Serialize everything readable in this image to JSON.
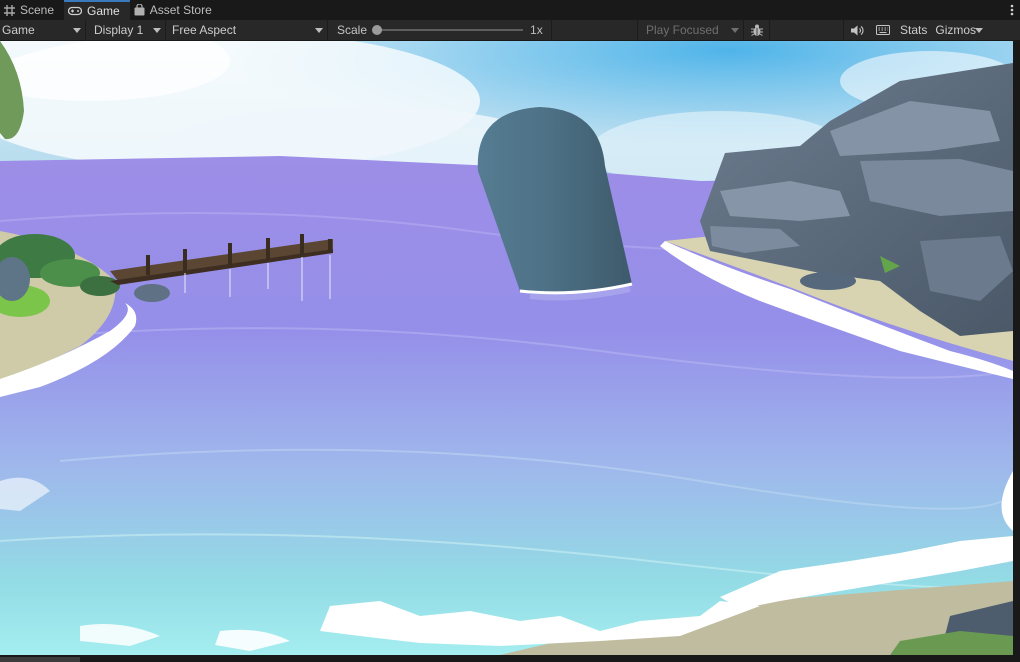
{
  "tabs": [
    {
      "label": "Scene",
      "icon": "scene-grid-icon",
      "active": false
    },
    {
      "label": "Game",
      "icon": "game-controller-icon",
      "active": true
    },
    {
      "label": "Asset Store",
      "icon": "shopping-bag-icon",
      "active": false
    }
  ],
  "tab_menu_icon": "kebab-menu-icon",
  "toolbar": {
    "view_mode": "Game",
    "display": "Display 1",
    "aspect": "Free Aspect",
    "scale_label": "Scale",
    "scale_value": "1x",
    "scale_fraction": 0.0,
    "play_mode": "Play Focused",
    "bug_icon": "bug-icon",
    "audio_icon": "speaker-icon",
    "keyboard_icon": "keyboard-icon",
    "stats": "Stats",
    "gizmos": "Gizmos"
  },
  "colors": {
    "accent": "#3a79bb",
    "panel": "#282828",
    "background": "#191919",
    "water_violet": "#8f86e6",
    "water_cyan": "#8fe3e6",
    "capsule": "#4d6e82",
    "rock": "#5c6c7e",
    "sand": "#c9c6a6"
  }
}
